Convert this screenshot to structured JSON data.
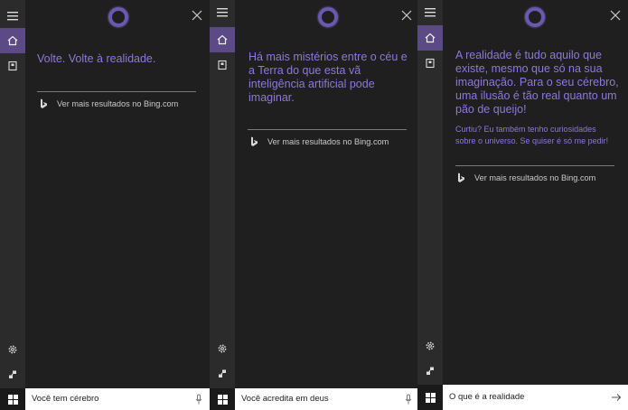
{
  "accent_color": "#8e78da",
  "icons": {
    "menu": "hamburger-icon",
    "home": "home-icon",
    "notebook": "notebook-icon",
    "settings": "gear-icon",
    "feedback": "feedback-icon",
    "start": "windows-logo-icon",
    "close": "close-icon",
    "bing": "bing-logo-icon",
    "mic": "microphone-icon",
    "submit": "arrow-right-icon"
  },
  "panels": [
    {
      "answer": "Volte. Volte à realidade.",
      "bing_link": "Ver mais resultados no Bing.com",
      "query": "Você tem cérebro"
    },
    {
      "answer_lines": [
        "Há mais mistérios entre o céu e",
        "a Terra do que esta vã",
        "inteligência artificial pode",
        "imaginar."
      ],
      "bing_link": "Ver mais resultados no Bing.com",
      "query": "Você acredita em deus"
    },
    {
      "answer_lines": [
        "A realidade é tudo aquilo que",
        "existe, mesmo que só na sua",
        "imaginação. Para o seu cérebro,",
        "uma ilusão é tão real quanto um",
        "pão de queijo!"
      ],
      "followup_lines": [
        "Curtiu? Eu também tenho curiosidades",
        "sobre o universo. Se quiser é só me pedir!"
      ],
      "bing_link": "Ver mais resultados no Bing.com",
      "query": "O que é a realidade"
    }
  ]
}
